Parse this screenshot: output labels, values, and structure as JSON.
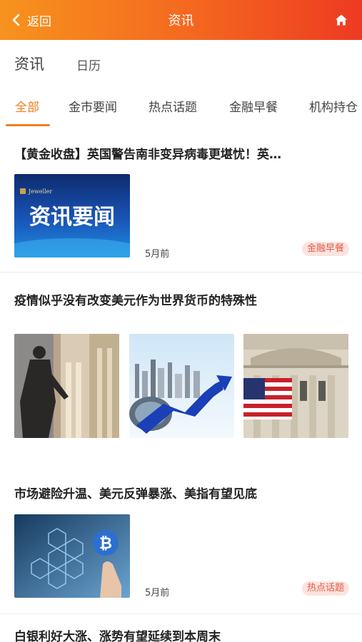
{
  "header": {
    "back_label": "返回",
    "title": "资讯"
  },
  "subnav": {
    "tabs": [
      "资讯",
      "日历"
    ]
  },
  "categories": [
    "全部",
    "金市要闻",
    "热点话题",
    "金融早餐",
    "机构持仓"
  ],
  "articles": [
    {
      "title": "【黄金收盘】英国警告南非变异病毒更堪忧！英…",
      "image_text": "资讯要闻",
      "image_logo": "Jeweller",
      "time": "5月前",
      "tag": "金融早餐"
    },
    {
      "title": "疫情似乎没有改变美元作为世界货币的特殊性"
    },
    {
      "title": "市场避险升温、美元反弹暴涨、美指有望见底",
      "time": "5月前",
      "tag": "热点话题"
    },
    {
      "title": "白银利好大涨、涨势有望延续到本周末"
    }
  ],
  "colors": {
    "accent": "#f37d1e",
    "header_start": "#f7931e",
    "header_end": "#ee3a22",
    "tag_bg": "#fde3de",
    "tag_text": "#e15a4a"
  }
}
